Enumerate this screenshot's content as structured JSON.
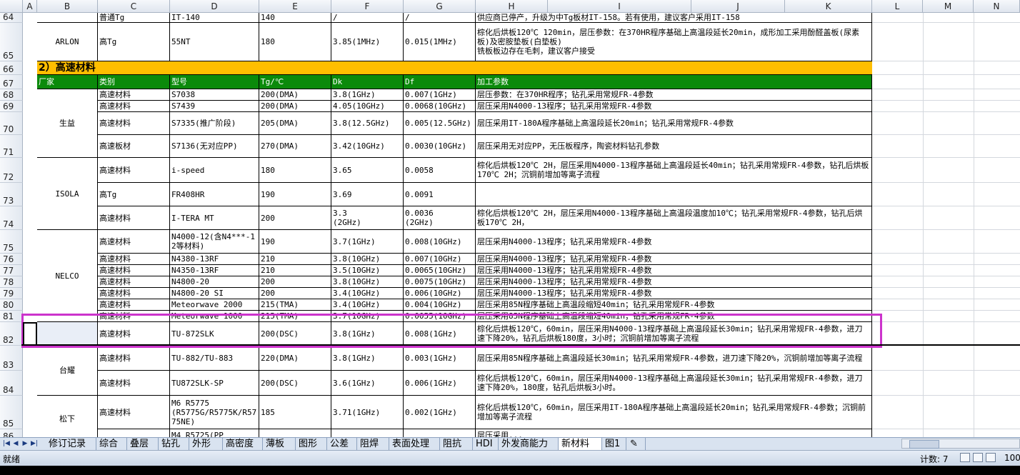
{
  "columns": [
    "A",
    "B",
    "C",
    "D",
    "E",
    "F",
    "G",
    "H",
    "I",
    "J",
    "K",
    "L",
    "M",
    "N"
  ],
  "section_title": "2）高速材料",
  "header_row": {
    "row": "67",
    "vendor": "厂家",
    "type": "类别",
    "model": "型号",
    "tg": "Tg/℃",
    "dk": "Dk",
    "df": "Df",
    "params": "加工参数"
  },
  "rows": [
    {
      "row": "64",
      "type": "普通Tg",
      "model": "IT-140",
      "tg": "140",
      "dk": "/",
      "df": "/",
      "params": "供应商已停产，升级为中Tg板材IT-158。若有使用，建议客户采用IT-158"
    },
    {
      "row": "65",
      "type": "高Tg",
      "model": "55NT",
      "tg": "180",
      "dk": "3.85(1MHz)",
      "df": "0.015(1MHz)",
      "params": "棕化后烘板120℃ 120min，层压参数：在370HR程序基础上高温段延长20min，成形加工采用酚醛盖板(尿素板)及密胺垫板(白垫板)\n铣板板边存在毛刺，建议客户接受"
    },
    {
      "row": "68",
      "type": "高速材料",
      "model": "S7038",
      "tg": "200(DMA)",
      "dk": "3.8(1GHz)",
      "df": "0.007(1GHz)",
      "params": "层压参数：在370HR程序；钻孔采用常规FR-4参数"
    },
    {
      "row": "69",
      "type": "高速材料",
      "model": "S7439",
      "tg": "200(DMA)",
      "dk": "4.05(10GHz)",
      "df": "0.0068(10GHz)",
      "params": "层压采用N4000-13程序；钻孔采用常规FR-4参数"
    },
    {
      "row": "70",
      "type": "高速材料",
      "model": "S7335(推广阶段)",
      "tg": "205(DMA)",
      "dk": "3.8(12.5GHz)",
      "df": "0.005(12.5GHz)",
      "params": "层压采用IT-180A程序基础上高温段延长20min；钻孔采用常规FR-4参数"
    },
    {
      "row": "71",
      "type": "高速板材",
      "model": "S7136(无对应PP)",
      "tg": "270(DMA)",
      "dk": "3.42(10GHz)",
      "df": "0.0030(10GHz)",
      "params": "层压采用无对应PP，无压板程序，陶瓷材料钻孔参数"
    },
    {
      "row": "72",
      "type": "高速材料",
      "model": "i-speed",
      "tg": "180",
      "dk": "3.65",
      "df": "0.0058",
      "params": "棕化后烘板120℃ 2H，层压采用N4000-13程序基础上高温段延长40min；钻孔采用常规FR-4参数，钻孔后烘板170℃ 2H；沉铜前增加等离子流程"
    },
    {
      "row": "73",
      "type": "高Tg",
      "model": "FR408HR",
      "tg": "190",
      "dk": "3.69",
      "df": "0.0091",
      "params": ""
    },
    {
      "row": "74",
      "type": "高速材料",
      "model": "I-TERA MT",
      "tg": "200",
      "dk": "3.3\n(2GHz)",
      "df": "0.0036\n(2GHz)",
      "params": "棕化后烘板120℃ 2H，层压采用N4000-13程序基础上高温段温度加10℃；钻孔采用常规FR-4参数，钻孔后烘板170℃ 2H，"
    },
    {
      "row": "75",
      "type": "高速材料",
      "model": "N4000-12(含N4***-12等材料)",
      "tg": "190",
      "dk": "3.7(1GHz)",
      "df": "0.008(10GHz)",
      "params": "层压采用N4000-13程序；钻孔采用常规FR-4参数"
    },
    {
      "row": "76",
      "type": "高速材料",
      "model": "N4380-13RF",
      "tg": "210",
      "dk": "3.8(10GHz)",
      "df": "0.007(10GHz)",
      "params": "层压采用N4000-13程序；钻孔采用常规FR-4参数"
    },
    {
      "row": "77",
      "type": "高速材料",
      "model": "N4350-13RF",
      "tg": "210",
      "dk": "3.5(10GHz)",
      "df": "0.0065(10GHz)",
      "params": "层压采用N4000-13程序；钻孔采用常规FR-4参数"
    },
    {
      "row": "78",
      "type": "高速材料",
      "model": "N4800-20",
      "tg": "200",
      "dk": "3.8(10GHz)",
      "df": "0.0075(10GHz)",
      "params": "层压采用N4000-13程序；钻孔采用常规FR-4参数"
    },
    {
      "row": "79",
      "type": "高速材料",
      "model": "N4800-20 SI",
      "tg": "200",
      "dk": "3.4(10GHz)",
      "df": "0.006(10GHz)",
      "params": "层压采用N4000-13程序；钻孔采用常规FR-4参数"
    },
    {
      "row": "80",
      "type": "高速材料",
      "model": "Meteorwave 2000",
      "tg": "215(TMA)",
      "dk": "3.4(10GHz)",
      "df": "0.004(10GHz)",
      "params": "层压采用85N程序基础上高温段缩短40min；钻孔采用常规FR-4参数"
    },
    {
      "row": "81",
      "type": "高速材料",
      "model": "Meteorwave 1000",
      "tg": "215(TMA)",
      "dk": "3.7(10GHz)",
      "df": "0.0055(10GHz)",
      "params": "层压采用85N程序基础上高温段缩短40min；钻孔采用常规FR-4参数"
    },
    {
      "row": "82",
      "type": "高速材料",
      "model": "TU-872SLK",
      "tg": "200(DSC)",
      "dk": "3.8(1GHz)",
      "df": "0.008(1GHz)",
      "params": "棕化后烘板120℃，60min，层压采用N4000-13程序基础上高温段延长30min；钻孔采用常规FR-4参数，进刀速下降20%，钻孔后烘板180度，3小时；沉铜前增加等离子流程"
    },
    {
      "row": "83",
      "type": "高速材料",
      "model": "TU-882/TU-883",
      "tg": "220(DMA)",
      "dk": "3.8(1GHz)",
      "df": "0.003(1GHz)",
      "params": "层压采用85N程序基础上高温段延长30min；钻孔采用常规FR-4参数，进刀速下降20%，沉铜前增加等离子流程"
    },
    {
      "row": "84",
      "type": "高速材料",
      "model": "TU872SLK-SP",
      "tg": "200(DSC)",
      "dk": "3.6(1GHz)",
      "df": "0.006(1GHz)",
      "params": "棕化后烘板120℃，60min，层压采用N4000-13程序基础上高温段延长30min；钻孔采用常规FR-4参数，进刀速下降20%，180度，钻孔后烘板3小时。"
    },
    {
      "row": "85",
      "type": "高速材料",
      "model": "M6 R5775\n(R5775G/R5775K/R5775NE)",
      "tg": "185",
      "dk": "3.71(1GHz)",
      "df": "0.002(1GHz)",
      "params": "棕化后烘板120℃，60min，层压采用IT-180A程序基础上高温段延长20min；钻孔采用常规FR-4参数；沉铜前增加等离子流程"
    },
    {
      "row": "86",
      "type": "",
      "model": "M4 R5725(PP",
      "tg": "",
      "dk": "",
      "df": "",
      "params": "层压采用..."
    }
  ],
  "vendors": [
    {
      "name": "ARLON"
    },
    {
      "name": "生益"
    },
    {
      "name": "ISOLA"
    },
    {
      "name": "NELCO"
    },
    {
      "name": "台耀"
    },
    {
      "name": "松下"
    }
  ],
  "tabs": [
    "修订记录",
    "综合",
    "叠层",
    "钻孔",
    "外形",
    "高密度",
    "薄板",
    "图形",
    "公差",
    "阻焊",
    "表面处理",
    "阻抗",
    "HDI",
    "外发商能力",
    "新材料",
    "图1"
  ],
  "active_tab": "新材料",
  "status": {
    "ready": "就绪",
    "count": "计数: 7",
    "zoom": "100"
  },
  "colors": {
    "header_green": "#0b8a0b",
    "section_yellow": "#ffbe00",
    "highlight_magenta": "#cc33cc"
  }
}
